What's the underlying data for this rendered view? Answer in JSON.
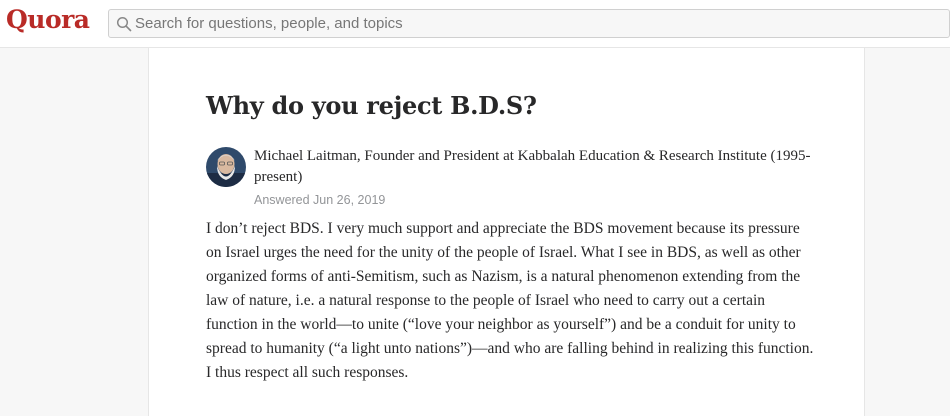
{
  "header": {
    "logo": "Quora",
    "search_placeholder": "Search for questions, people, and topics"
  },
  "question": {
    "title": "Why do you reject B.D.S?"
  },
  "answer": {
    "author": "Michael Laitman, Founder and President at Kabbalah Education & Research Institute (1995-present)",
    "answered": "Answered Jun 26, 2019",
    "text": "I don’t reject BDS. I very much support and appreciate the BDS movement because its pressure on Israel urges the need for the unity of the people of Israel. What I see in BDS, as well as other organized forms of anti-Semitism, such as Nazism, is a natural phenomenon extending from the law of nature, i.e. a natural response to the people of Israel who need to carry out a certain function in the world—to unite (“love your neighbor as yourself”) and be a conduit for unity to spread to humanity (“a light unto nations”)—and who are falling behind in realizing this function. I thus respect all such responses."
  },
  "colors": {
    "brand": "#b92b27",
    "text": "#282829",
    "muted": "#939598",
    "background": "#f7f7f7"
  },
  "icons": {
    "search": "search-icon"
  }
}
